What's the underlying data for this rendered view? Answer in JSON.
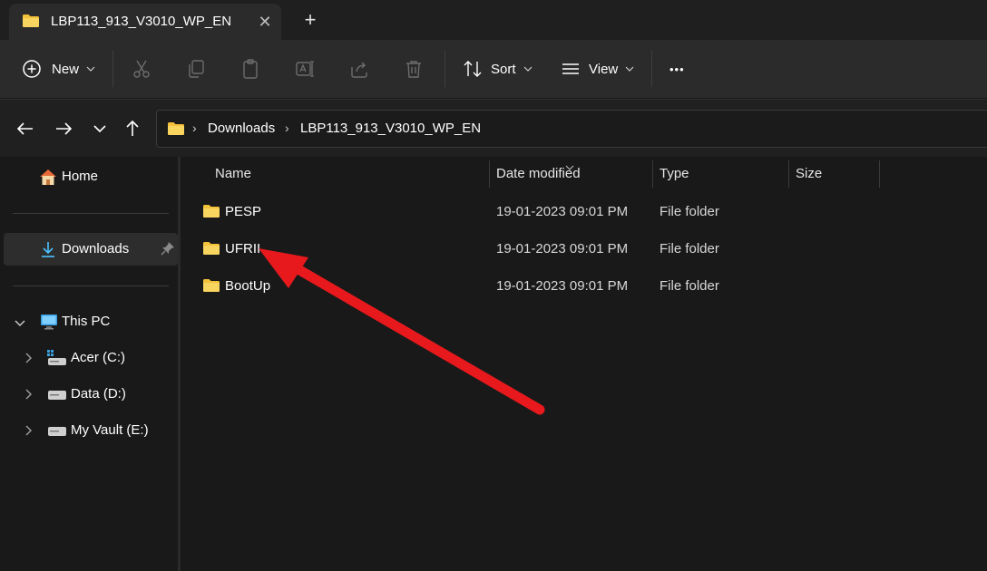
{
  "window": {
    "tab_title": "LBP113_913_V3010_WP_EN",
    "close_glyph": "✕",
    "new_tab_glyph": "+"
  },
  "toolbar": {
    "new_label": "New",
    "sort_label": "Sort",
    "view_label": "View",
    "more_glyph": "•••"
  },
  "breadcrumb": {
    "items": [
      "Downloads",
      "LBP113_913_V3010_WP_EN"
    ],
    "separator": "›"
  },
  "sidebar": {
    "home": "Home",
    "downloads": "Downloads",
    "this_pc": "This PC",
    "drives": [
      "Acer (C:)",
      "Data (D:)",
      "My Vault (E:)"
    ],
    "expand_glyph": "›",
    "collapse_glyph": "⌄"
  },
  "file_list": {
    "columns": [
      "Name",
      "Date modified",
      "Type",
      "Size"
    ],
    "rows": [
      {
        "name": "PESP",
        "date": "19-01-2023 09:01 PM",
        "type": "File folder",
        "size": ""
      },
      {
        "name": "UFRII",
        "date": "19-01-2023 09:01 PM",
        "type": "File folder",
        "size": ""
      },
      {
        "name": "BootUp",
        "date": "19-01-2023 09:01 PM",
        "type": "File folder",
        "size": ""
      }
    ]
  },
  "colors": {
    "folder": "#f3c13a",
    "accent": "#4cc2ff",
    "annotation": "#e8191c"
  },
  "icons": {
    "tab": "folder-icon",
    "new": "plus-circle-icon",
    "cut": "scissors-icon",
    "copy": "copy-icon",
    "paste": "clipboard-icon",
    "rename": "rename-icon",
    "share": "share-icon",
    "delete": "trash-icon",
    "sort": "sort-icon",
    "view": "view-lines-icon",
    "home": "home-icon",
    "downloads": "download-arrow-icon",
    "pin": "pin-icon",
    "this_pc": "monitor-icon",
    "drive": "drive-icon"
  }
}
